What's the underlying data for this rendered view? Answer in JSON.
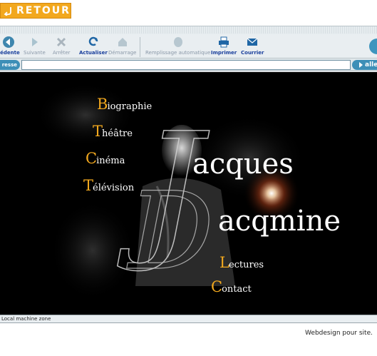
{
  "retour": {
    "label": "RETOUR"
  },
  "toolbar": {
    "items": [
      {
        "label": "cédente",
        "icon": "back-arrow-icon"
      },
      {
        "label": "Suivante",
        "icon": "forward-arrow-icon"
      },
      {
        "label": "Arrêter",
        "icon": "stop-icon"
      },
      {
        "label": "Actualiser",
        "icon": "refresh-icon"
      },
      {
        "label": "Démarrage",
        "icon": "home-icon"
      },
      {
        "label": "Remplissage automatique",
        "icon": "autofill-icon"
      },
      {
        "label": "Imprimer",
        "icon": "printer-icon"
      },
      {
        "label": "Courrier",
        "icon": "mail-icon"
      }
    ]
  },
  "address": {
    "label": "resse",
    "value": "",
    "go_label": "alle"
  },
  "hero": {
    "first_name": "acques",
    "last_name": "acqmine",
    "big_j": "J",
    "big_d": "D"
  },
  "nav": [
    {
      "initial": "B",
      "rest": "iographie"
    },
    {
      "initial": "T",
      "rest": "héâtre"
    },
    {
      "initial": "C",
      "rest": "inéma"
    },
    {
      "initial": "T",
      "rest": "élévision"
    },
    {
      "initial": "L",
      "rest": "ectures"
    },
    {
      "initial": "C",
      "rest": "ontact"
    }
  ],
  "status": {
    "zone": "Local machine zone"
  },
  "footer": {
    "credit": "Webdesign pour site."
  },
  "colors": {
    "accent": "#f2a81e",
    "toolbar_text": "#1a3f9c",
    "address_blue": "#3d8fb7"
  }
}
